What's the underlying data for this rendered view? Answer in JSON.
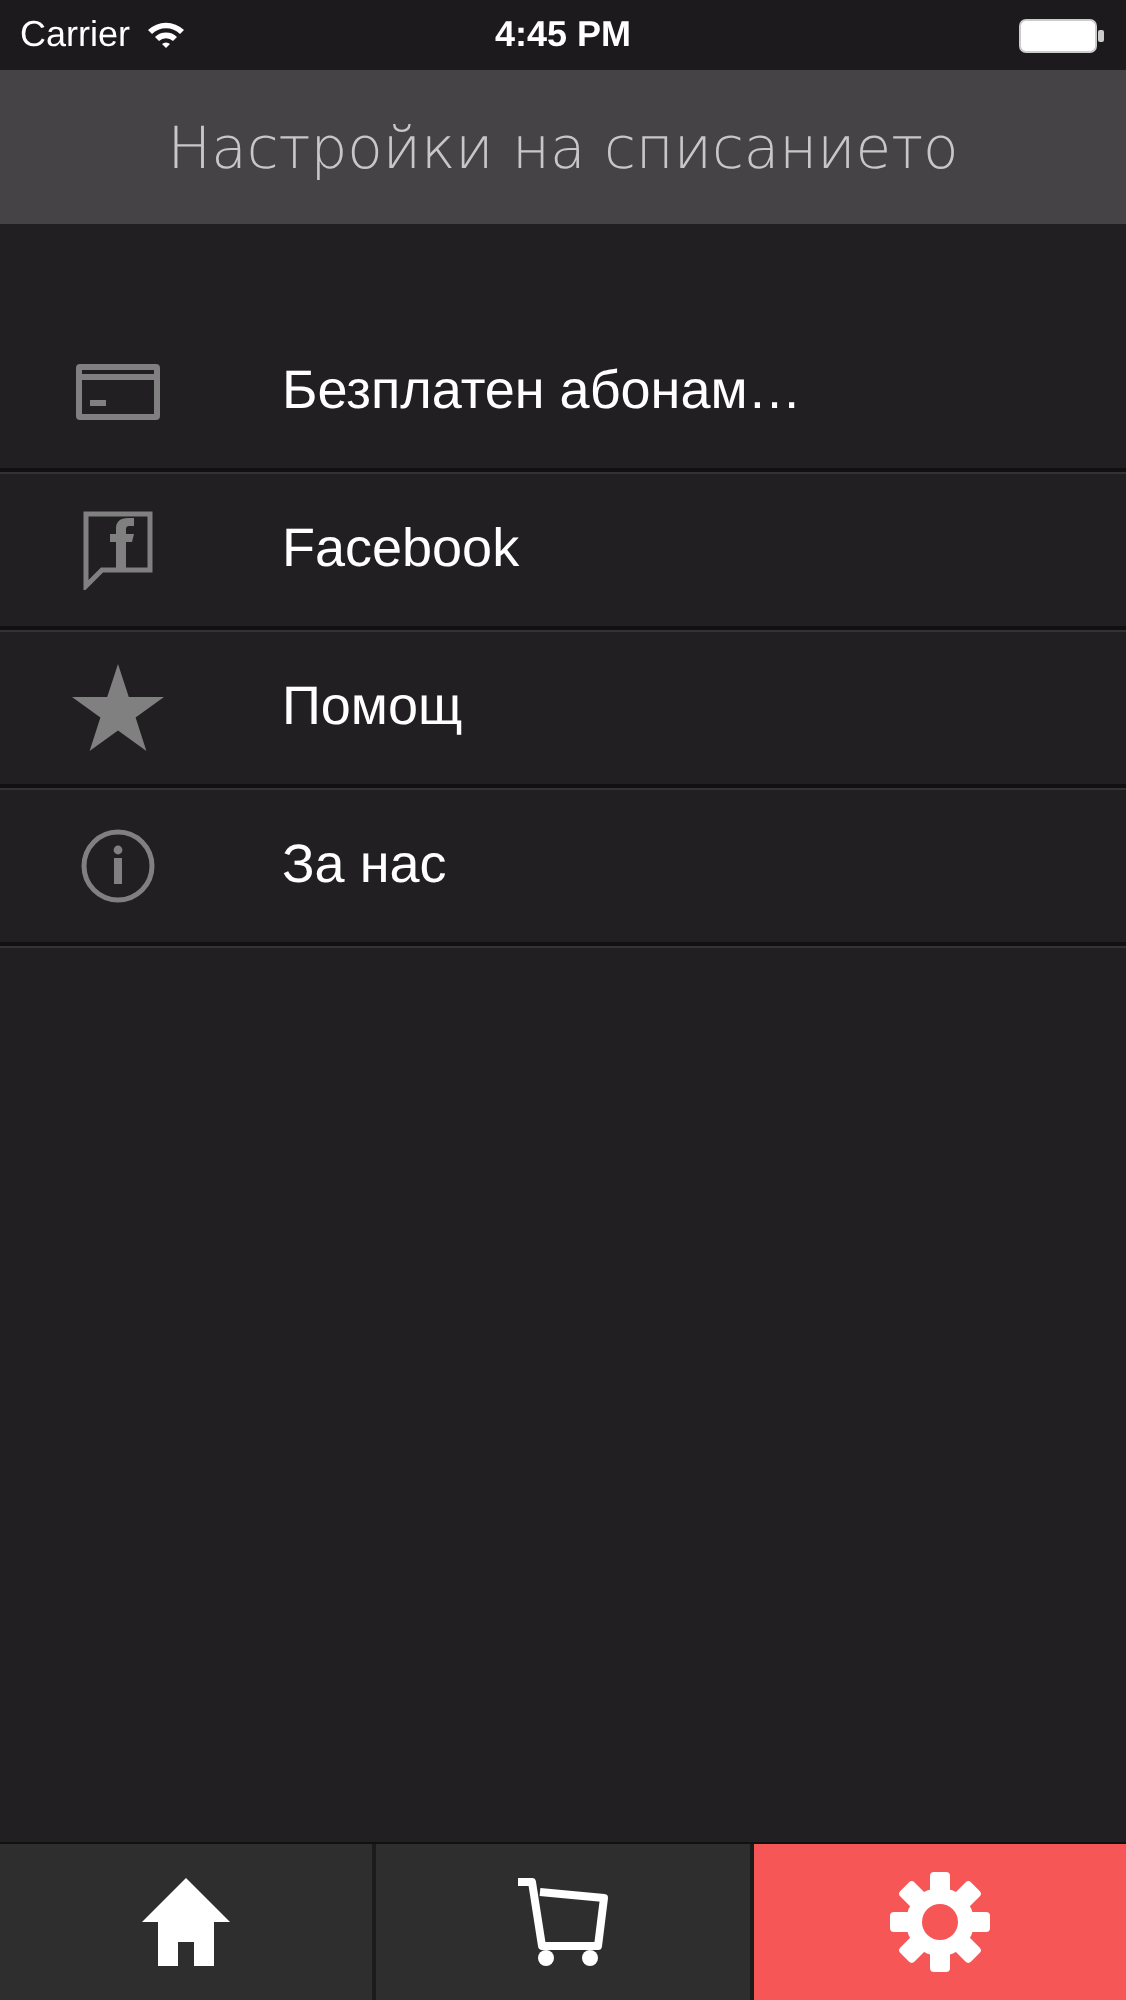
{
  "status_bar": {
    "carrier": "Carrier",
    "time": "4:45 PM"
  },
  "nav_bar": {
    "title": "Настройки на списанието"
  },
  "menu": [
    {
      "kind": "card",
      "label": "Безплатен абонам…"
    },
    {
      "kind": "facebook",
      "label": "Facebook"
    },
    {
      "kind": "star",
      "label": "Помощ"
    },
    {
      "kind": "info",
      "label": "За нас"
    }
  ],
  "tab_bar": [
    {
      "kind": "home",
      "selected": false
    },
    {
      "kind": "cart",
      "selected": false
    },
    {
      "kind": "gear",
      "selected": true
    }
  ]
}
